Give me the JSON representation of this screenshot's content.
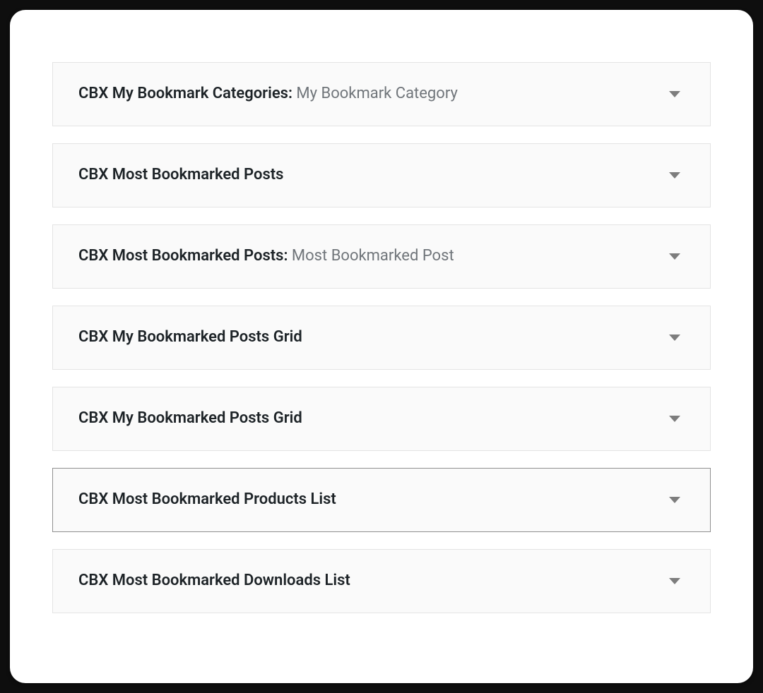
{
  "widgets": [
    {
      "title": "CBX My Bookmark Categories:",
      "subtitle": " My Bookmark Category",
      "focused": false
    },
    {
      "title": "CBX Most Bookmarked Posts",
      "subtitle": "",
      "focused": false
    },
    {
      "title": "CBX Most Bookmarked Posts:",
      "subtitle": " Most Bookmarked Post",
      "focused": false
    },
    {
      "title": "CBX My Bookmarked Posts Grid",
      "subtitle": "",
      "focused": false
    },
    {
      "title": "CBX My Bookmarked Posts Grid",
      "subtitle": "",
      "focused": false
    },
    {
      "title": "CBX Most Bookmarked Products List",
      "subtitle": "",
      "focused": true
    },
    {
      "title": "CBX Most Bookmarked Downloads List",
      "subtitle": "",
      "focused": false
    }
  ]
}
